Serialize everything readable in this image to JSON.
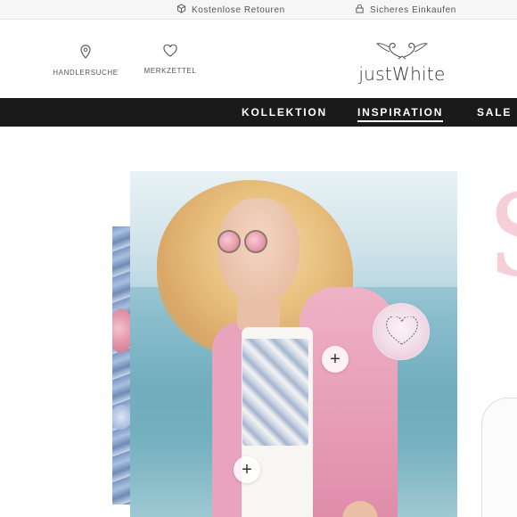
{
  "topbar": {
    "items": [
      {
        "icon": "package-icon",
        "label": "Kostenlose Retouren"
      },
      {
        "icon": "lock-icon",
        "label": "Sicheres Einkaufen"
      }
    ]
  },
  "header": {
    "links": [
      {
        "icon": "map-pin-icon",
        "label": "HANDLERSUCHE"
      },
      {
        "icon": "heart-icon",
        "label": "MERKZETTEL"
      }
    ],
    "logo_text": "justWhite"
  },
  "nav": {
    "items": [
      {
        "label": "KOLLEKTION",
        "active": false
      },
      {
        "label": "INSPIRATION",
        "active": true
      },
      {
        "label": "SALE",
        "active": false
      }
    ]
  },
  "hero": {
    "hotspots": [
      "+",
      "+"
    ]
  },
  "side": {
    "letter": "S"
  },
  "colors": {
    "nav_bg": "#1a1a1a",
    "accent_pink": "#e9a3bd",
    "topbar_bg": "#f6f6f6"
  }
}
